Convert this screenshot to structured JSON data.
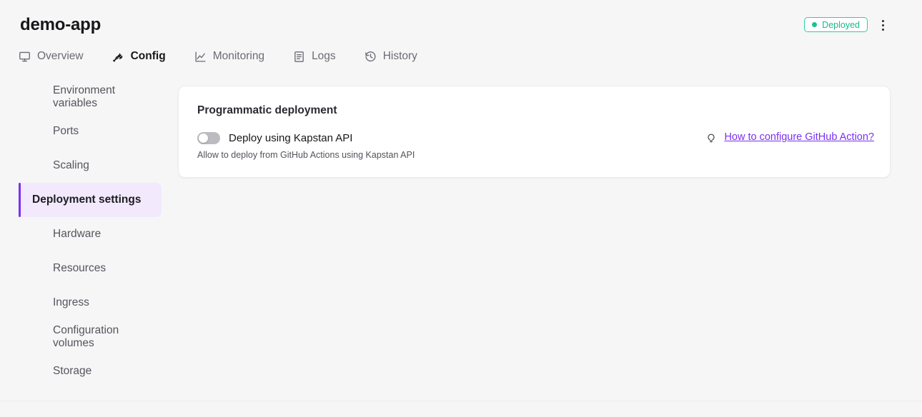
{
  "header": {
    "app_title": "demo-app",
    "status": {
      "label": "Deployed",
      "dot_icon": "status-dot-icon",
      "color": "#19b88a",
      "border_color": "#2ecf9b"
    },
    "more_menu_icon": "kebab-menu-icon"
  },
  "tabs": [
    {
      "label": "Overview",
      "icon": "monitor-icon",
      "active": false
    },
    {
      "label": "Config",
      "icon": "wrench-icon",
      "active": true
    },
    {
      "label": "Monitoring",
      "icon": "line-chart-icon",
      "active": false
    },
    {
      "label": "Logs",
      "icon": "document-icon",
      "active": false
    },
    {
      "label": "History",
      "icon": "clock-undo-icon",
      "active": false
    }
  ],
  "sidebar": {
    "items": [
      {
        "label": "Environment variables",
        "active": false
      },
      {
        "label": "Ports",
        "active": false
      },
      {
        "label": "Scaling",
        "active": false
      },
      {
        "label": "Deployment settings",
        "active": true
      },
      {
        "label": "Hardware",
        "active": false
      },
      {
        "label": "Resources",
        "active": false
      },
      {
        "label": "Ingress",
        "active": false
      },
      {
        "label": "Configuration volumes",
        "active": false
      },
      {
        "label": "Storage",
        "active": false
      }
    ],
    "active_accent_color": "#7b2ff2",
    "active_background_color": "#f2e9fd"
  },
  "card": {
    "title": "Programmatic deployment",
    "toggle": {
      "label": "Deploy using Kapstan API",
      "description": "Allow to deploy from GitHub Actions using Kapstan API",
      "state": "off"
    },
    "help": {
      "icon": "lightbulb-icon",
      "link_text": "How to configure GitHub Action?",
      "link_color": "#7b2ff2"
    }
  }
}
